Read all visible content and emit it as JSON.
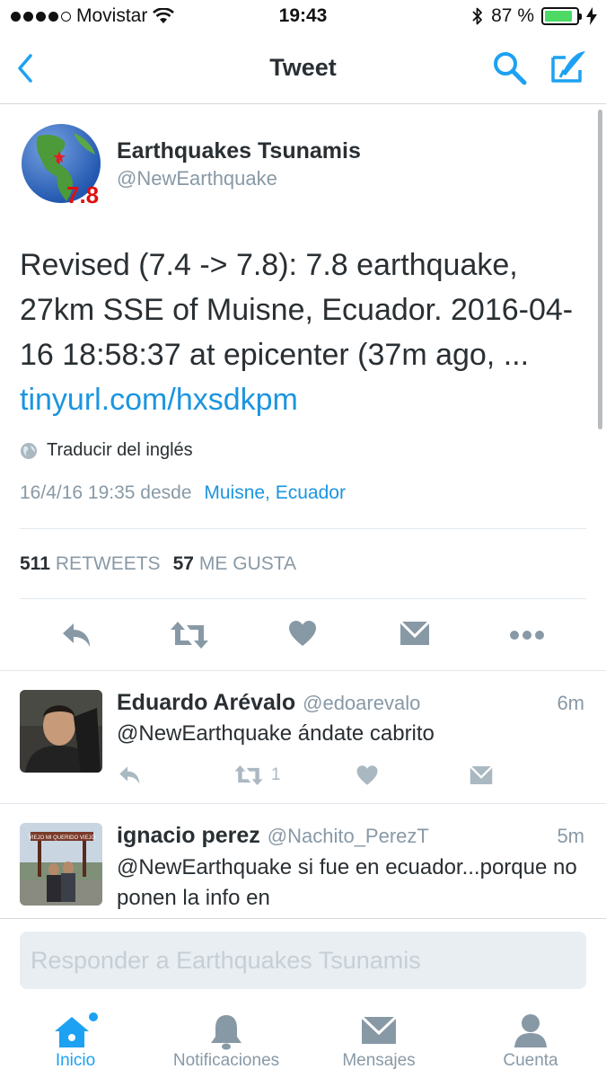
{
  "status_bar": {
    "carrier": "Movistar",
    "time": "19:43",
    "battery": "87 %",
    "battery_fraction": 0.87
  },
  "nav": {
    "title": "Tweet",
    "icons": [
      "back-chevron-icon",
      "search-icon",
      "compose-tweet-icon"
    ]
  },
  "tweet": {
    "author_name": "Earthquakes Tsunamis",
    "author_handle": "@NewEarthquake",
    "avatar_badge": "7.8",
    "text": "Revised (7.4 -> 7.8): 7.8 earthquake, 27km SSE of Muisne, Ecuador. 2016-04-16 18:58:37 at epicenter (37m ago, ... ",
    "link": "tinyurl.com/hxsdkpm",
    "translate": "Traducir del inglés",
    "timestamp": "16/4/16 19:35",
    "from_word": "desde",
    "location": "Muisne, Ecuador",
    "retweet_count": "511",
    "retweet_label": "RETWEETS",
    "like_count": "57",
    "like_label": "ME GUSTA"
  },
  "replies": [
    {
      "name": "Eduardo Arévalo",
      "handle": "@edoarevalo",
      "time": "6m",
      "text": "@NewEarthquake ándate cabrito",
      "retweets": "1"
    },
    {
      "name": "ignacio perez",
      "handle": "@Nachito_PerezT",
      "time": "5m",
      "text": "@NewEarthquake si fue en ecuador...porque no ponen la info en",
      "sign_text": "VIEJO MI QUERIDO VIEJO"
    }
  ],
  "reply_box": {
    "placeholder": "Responder a Earthquakes Tsunamis"
  },
  "tabs": [
    {
      "label": "Inicio",
      "icon": "home-icon",
      "active": true
    },
    {
      "label": "Notificaciones",
      "icon": "bell-icon",
      "active": false
    },
    {
      "label": "Mensajes",
      "icon": "envelope-icon",
      "active": false
    },
    {
      "label": "Cuenta",
      "icon": "person-icon",
      "active": false
    }
  ],
  "colors": {
    "accent": "#1da1f2",
    "link": "#1b95e0",
    "muted": "#8899a6",
    "text": "#292f33",
    "battery": "#4cd964"
  }
}
